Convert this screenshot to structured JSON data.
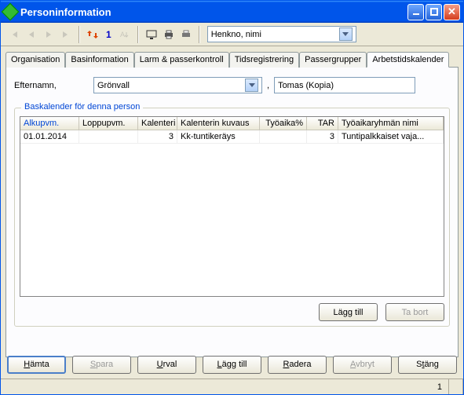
{
  "window": {
    "title": "Personinformation"
  },
  "toolbar": {
    "record_number": "1",
    "search_combo": "Henkno, nimi"
  },
  "tabs": [
    {
      "label": "Organisation"
    },
    {
      "label": "Basinformation"
    },
    {
      "label": "Larm & passerkontroll"
    },
    {
      "label": "Tidsregistrering"
    },
    {
      "label": "Passergrupper"
    },
    {
      "label": "Arbetstidskalender"
    }
  ],
  "form": {
    "lastname_label": "Efternamn,",
    "lastname_value": "Grönvall",
    "firstname_value": "Tomas (Kopia)"
  },
  "group": {
    "legend": "Baskalender för denna person",
    "columns": [
      "Alkupvm.",
      "Loppupvm.",
      "Kalenteri",
      "Kalenterin kuvaus",
      "Työaika%",
      "TAR",
      "Työaikaryhmän nimi"
    ],
    "rows": [
      {
        "start": "01.01.2014",
        "end": "",
        "cal": "3",
        "desc": "Kk-tuntikeräys",
        "pct": "",
        "tar": "3",
        "group": "Tuntipalkkaiset vaja..."
      }
    ],
    "add_label": "Lägg till",
    "remove_label": "Ta bort"
  },
  "buttons": {
    "fetch": "Hämta",
    "save": "Spara",
    "selection": "Urval",
    "add": "Lägg till",
    "delete": "Radera",
    "cancel": "Avbryt",
    "close": "Stäng"
  },
  "status": {
    "count": "1"
  }
}
